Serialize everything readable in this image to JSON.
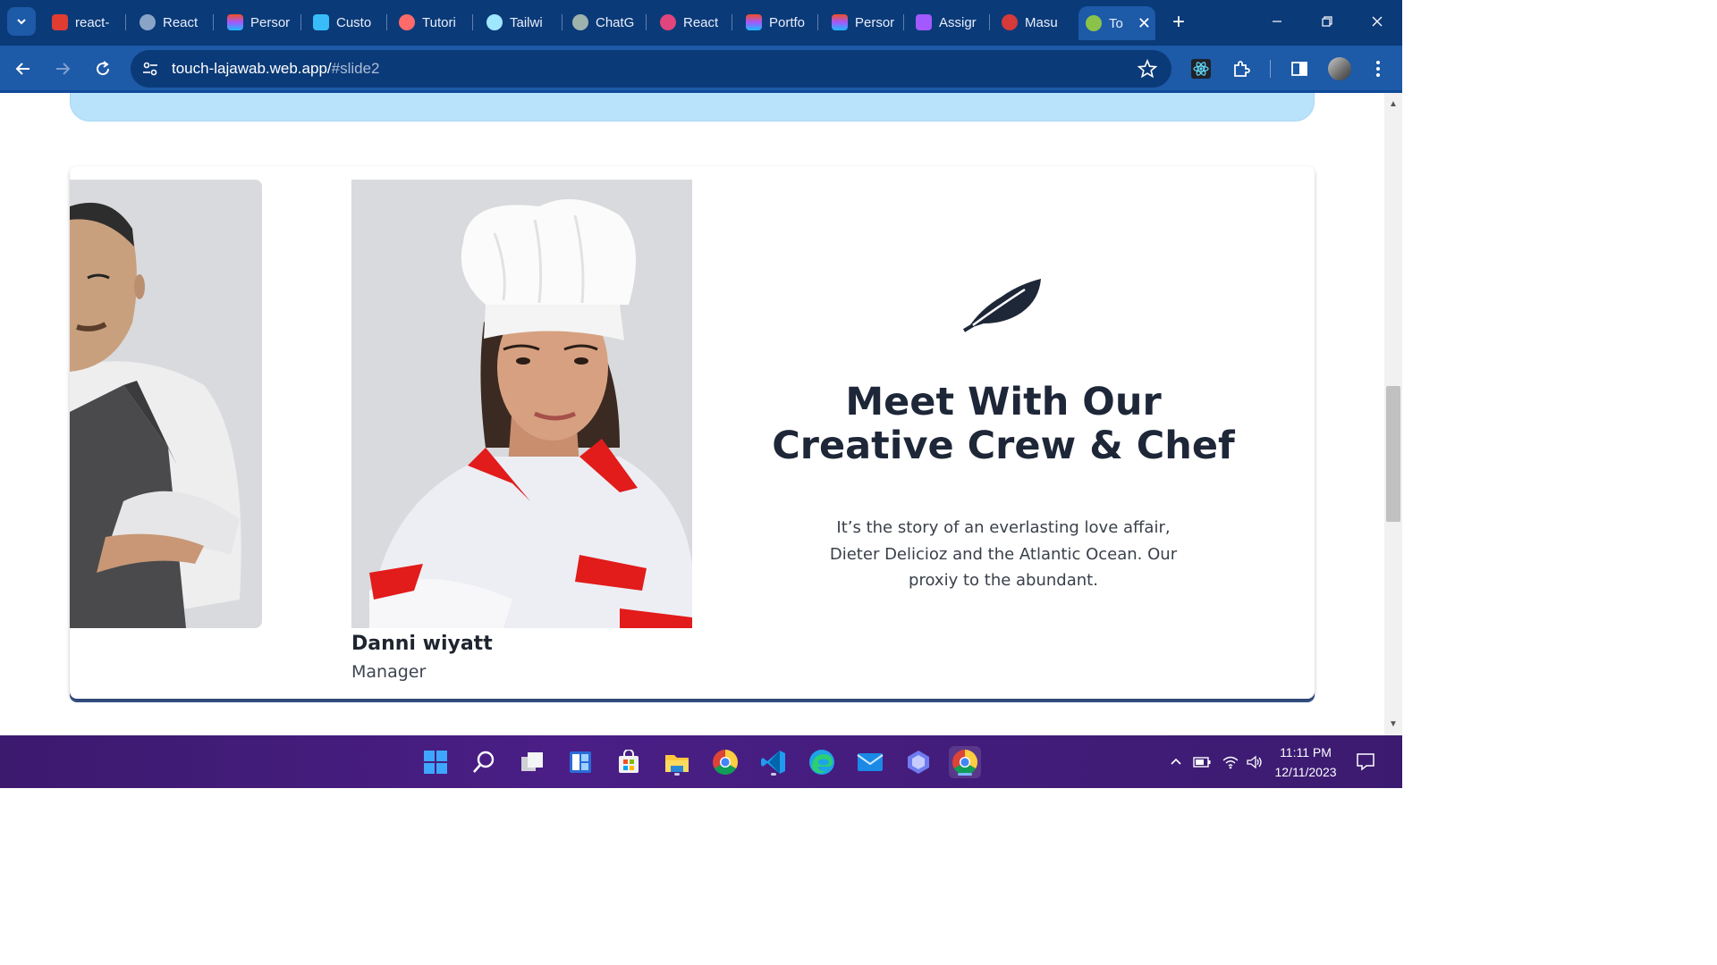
{
  "browser": {
    "tabs": [
      {
        "label": "react-",
        "color": "#e03c31"
      },
      {
        "label": "React",
        "color": "#8aa4c8"
      },
      {
        "label": "Persor",
        "color": "#f24e1e"
      },
      {
        "label": "Custo",
        "color": "#38bdf8"
      },
      {
        "label": "Tutori",
        "color": "#ff6b6b"
      },
      {
        "label": "Tailwi",
        "color": "#9ee7ff"
      },
      {
        "label": "ChatG",
        "color": "#9fb3ad"
      },
      {
        "label": "React",
        "color": "#e0457b"
      },
      {
        "label": "Portfo",
        "color": "#f24e1e"
      },
      {
        "label": "Persor",
        "color": "#f24e1e"
      },
      {
        "label": "Assigr",
        "color": "#a259ff"
      },
      {
        "label": "Masu",
        "color": "#d63a3a"
      }
    ],
    "active_tab": {
      "label": "To",
      "color": "#8bc34a"
    },
    "url_host": "touch-lajawab.web.app/",
    "url_path": "#slide2"
  },
  "page": {
    "team_member": {
      "name": "Danni wiyatt",
      "role": "Manager"
    },
    "heading": "Meet With Our Creative Crew & Chef",
    "blurb": "It’s the story of an everlasting love affair, Dieter Delicioz and the Atlantic Ocean. Our proxiy to the abundant."
  },
  "taskbar": {
    "time": "11:11 PM",
    "date": "12/11/2023"
  },
  "colors": {
    "tabbar": "#0b3a78",
    "toolbar": "#1d5aa8",
    "heading": "#1e2738",
    "banner": "#b9e3fb",
    "taskbar": "#4a1e86"
  }
}
